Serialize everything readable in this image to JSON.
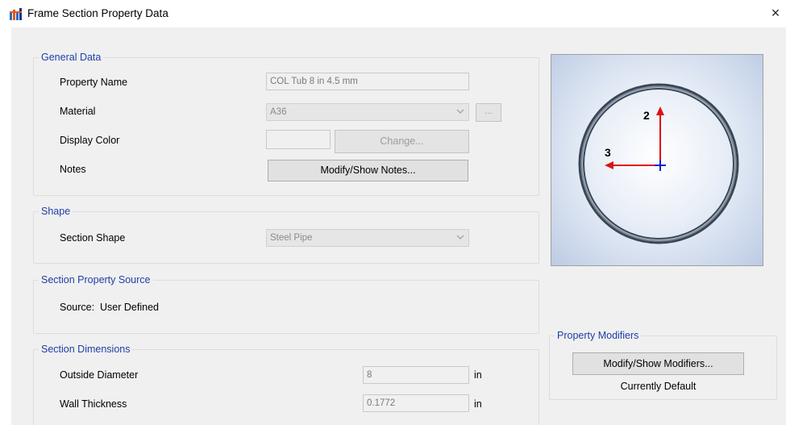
{
  "window": {
    "title": "Frame Section Property Data",
    "close_glyph": "×",
    "icon": "frame-section-icon"
  },
  "general_data": {
    "legend": "General Data",
    "property_name": {
      "label": "Property Name",
      "value": "COL Tub 8 in 4.5 mm"
    },
    "material": {
      "label": "Material",
      "value": "A36",
      "browse_label": "..."
    },
    "display_color": {
      "label": "Display Color",
      "swatch_color": "#f0f0f0",
      "change_label": "Change..."
    },
    "notes": {
      "label": "Notes",
      "button_label": "Modify/Show Notes..."
    }
  },
  "shape": {
    "legend": "Shape",
    "section_shape": {
      "label": "Section Shape",
      "value": "Steel Pipe"
    }
  },
  "source": {
    "legend": "Section Property Source",
    "text": "Source:  User Defined"
  },
  "dimensions": {
    "legend": "Section Dimensions",
    "outside_diameter": {
      "label": "Outside Diameter",
      "value": "8",
      "unit": "in"
    },
    "wall_thickness": {
      "label": "Wall Thickness",
      "value": "0.1772",
      "unit": "in"
    }
  },
  "preview": {
    "axis_2_label": "2",
    "axis_3_label": "3",
    "ring_color": "#3a4655",
    "axis_color": "#e01010",
    "centroid_color": "#1020d0"
  },
  "modifiers": {
    "legend": "Property Modifiers",
    "button_label": "Modify/Show Modifiers...",
    "status": "Currently Default"
  }
}
